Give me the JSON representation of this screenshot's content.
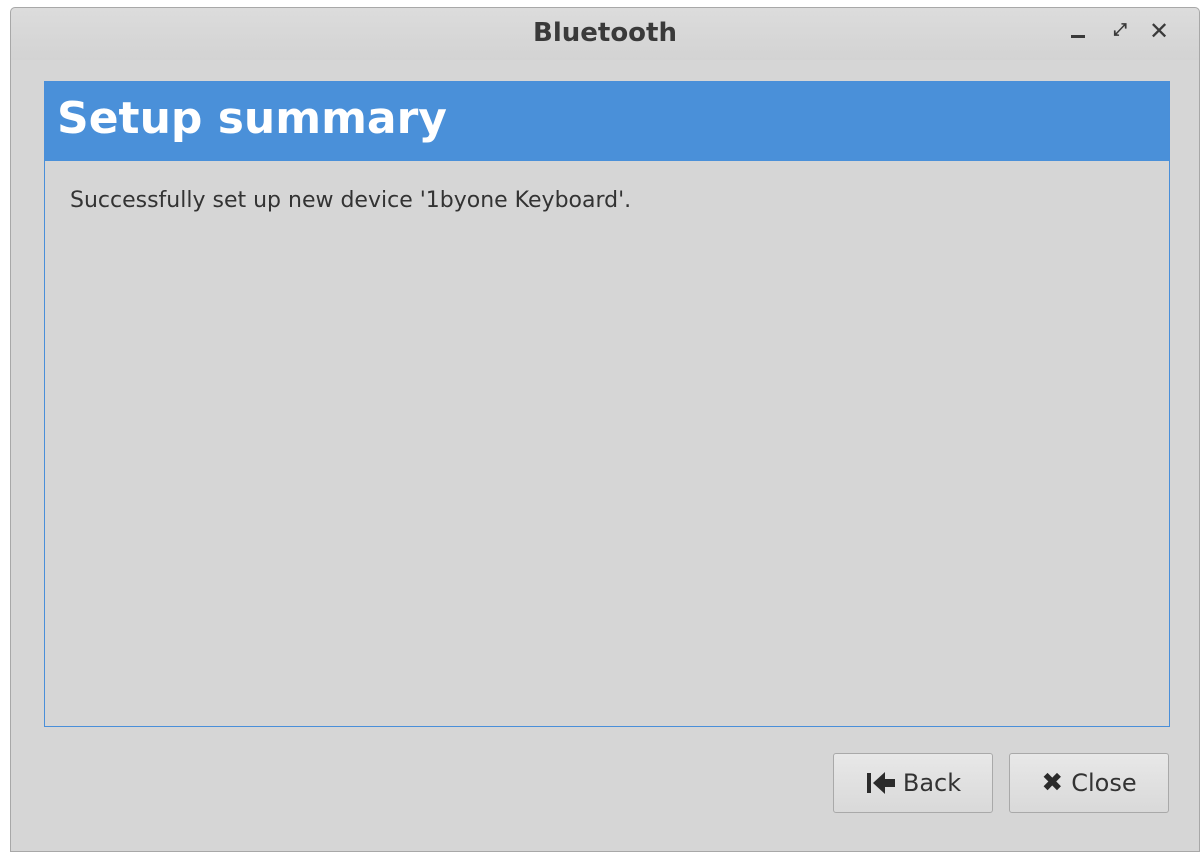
{
  "window": {
    "title": "Bluetooth",
    "controls": {
      "minimize_icon": "minimize-icon",
      "maximize_icon": "maximize-icon",
      "close_icon": "close-icon"
    }
  },
  "page": {
    "header_title": "Setup summary",
    "message": "Successfully set up new device '1byone Keyboard'.",
    "accent_color": "#4a90d9"
  },
  "buttons": {
    "back_label": "Back",
    "back_icon": "back-arrow-icon",
    "close_label": "Close",
    "close_icon": "close-x-icon"
  }
}
